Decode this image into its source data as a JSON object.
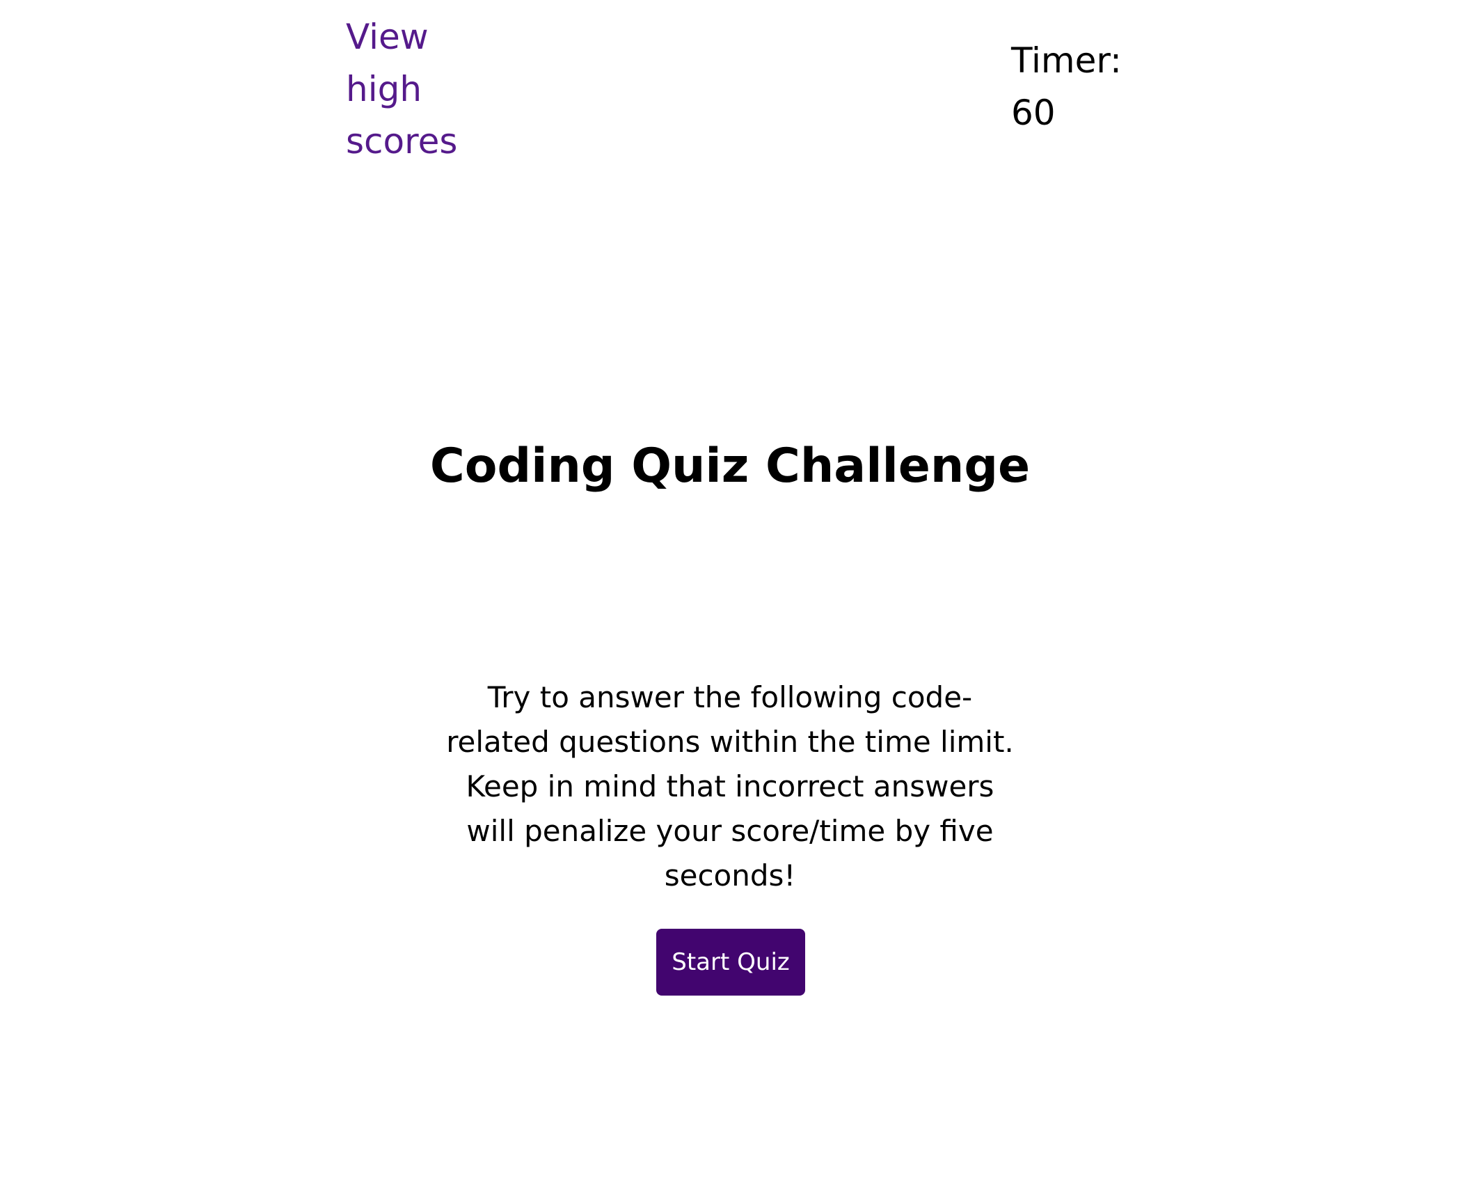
{
  "header": {
    "high_scores_link": "View high scores",
    "timer_label": "Timer:",
    "timer_value": "60"
  },
  "main": {
    "title": "Coding Quiz Challenge",
    "instructions": "Try to answer the following code-related questions within the time limit. Keep in mind that incorrect answers will penalize your score/time by five seconds!",
    "start_button": "Start Quiz"
  },
  "colors": {
    "link": "#551a8b",
    "button_background": "#42056f",
    "button_text": "#ffffff"
  }
}
